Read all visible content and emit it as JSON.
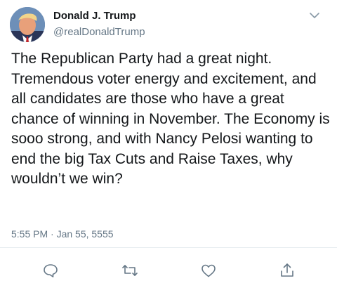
{
  "tweet": {
    "author": {
      "name": "Donald J. Trump",
      "handle": "@realDonaldTrump",
      "avatar_icon": "profile-photo"
    },
    "text": "The Republican Party had a great night. Tremendous voter energy and excitement, and all candidates are those who have a great chance of winning in November. The Economy is sooo strong, and with Nancy Pelosi wanting to end the big Tax Cuts and Raise Taxes, why wouldn’t we win?",
    "timestamp": "5:55 PM · Jan 55, 5555"
  },
  "actions": [
    {
      "name": "reply",
      "icon": "speech-bubble-icon"
    },
    {
      "name": "retweet",
      "icon": "retweet-icon"
    },
    {
      "name": "like",
      "icon": "heart-icon"
    },
    {
      "name": "share",
      "icon": "share-icon"
    }
  ],
  "colors": {
    "text": "#14171a",
    "secondary": "#657786",
    "divider": "#e6ecf0",
    "icon": "#657786"
  }
}
